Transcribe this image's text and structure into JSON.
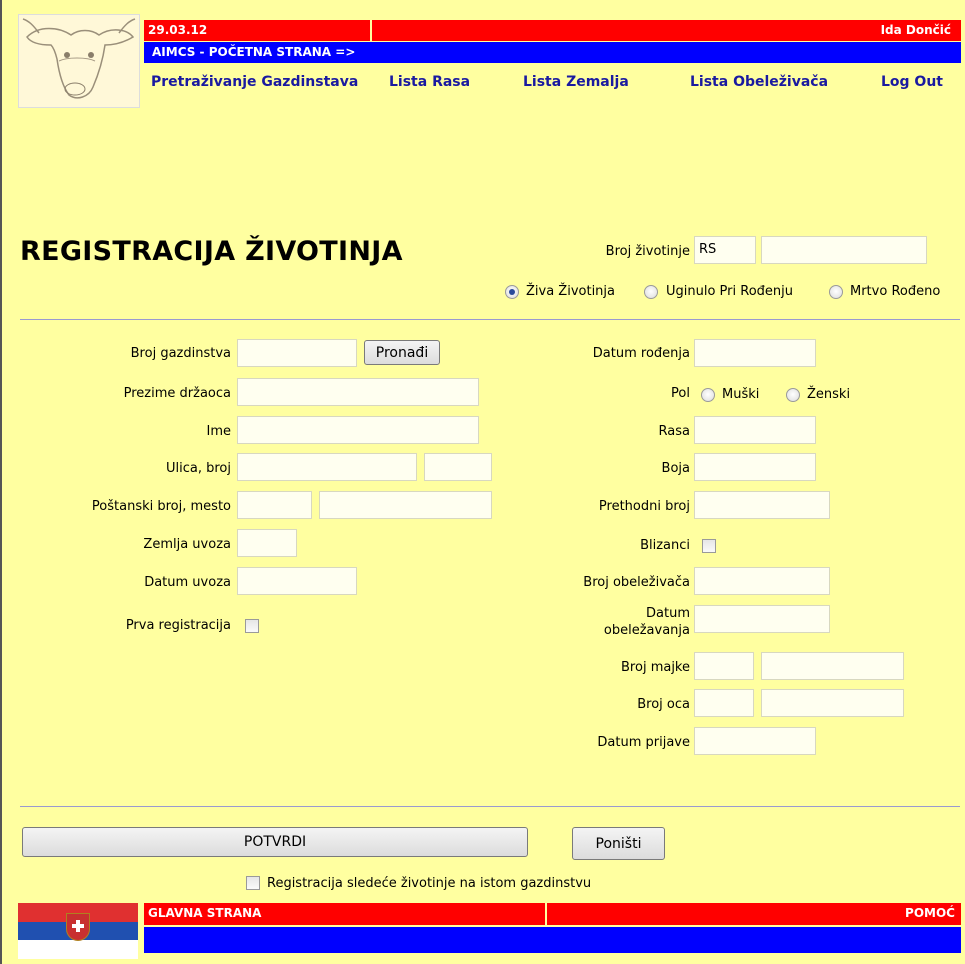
{
  "header": {
    "date": "29.03.12",
    "user": "Ida Dončić",
    "breadcrumb": "AIMCS - POČETNA STRANA  =>",
    "nav": [
      "Pretraživanje Gazdinstava",
      "Lista Rasa",
      "Lista Zemalja",
      "Lista Obeleživača",
      "Log Out"
    ]
  },
  "title": "REGISTRACIJA ŽIVOTINJA",
  "animal_number": {
    "label": "Broj životinje",
    "prefix": "RS",
    "value": ""
  },
  "status_options": [
    {
      "label": "Živa Životinja",
      "selected": true
    },
    {
      "label": "Uginulo Pri Rođenju",
      "selected": false
    },
    {
      "label": "Mrtvo Rođeno",
      "selected": false
    }
  ],
  "left_form": {
    "broj_gazdinstva": "Broj gazdinstva",
    "pronadji": "Pronađi",
    "prezime": "Prezime držaoca",
    "ime": "Ime",
    "ulica": "Ulica, broj",
    "postanski": "Poštanski broj, mesto",
    "zemlja": "Zemlja uvoza",
    "datum_uvoza": "Datum uvoza",
    "prva_registracija": "Prva registracija"
  },
  "right_form": {
    "datum_rodjenja": "Datum rođenja",
    "pol": "Pol",
    "muski": "Muški",
    "zenski": "Ženski",
    "rasa": "Rasa",
    "boja": "Boja",
    "prethodni_broj": "Prethodni broj",
    "blizanci": "Blizanci",
    "broj_obelezivaca": "Broj obeleživača",
    "datum_obelezavanja_1": "Datum",
    "datum_obelezavanja_2": "obeležavanja",
    "broj_majke": "Broj majke",
    "broj_oca": "Broj oca",
    "datum_prijave": "Datum prijave"
  },
  "actions": {
    "confirm": "POTVRDI",
    "cancel": "Poništi",
    "next_same_farm": "Registracija sledeće životinje na istom gazdinstvu"
  },
  "footer": {
    "home": "GLAVNA STRANA",
    "help": "POMOĆ"
  },
  "colors": {
    "background": "#ffffa0",
    "bar_red": "#ff0000",
    "bar_blue": "#0000ff",
    "nav_text": "#1a1aa0"
  }
}
